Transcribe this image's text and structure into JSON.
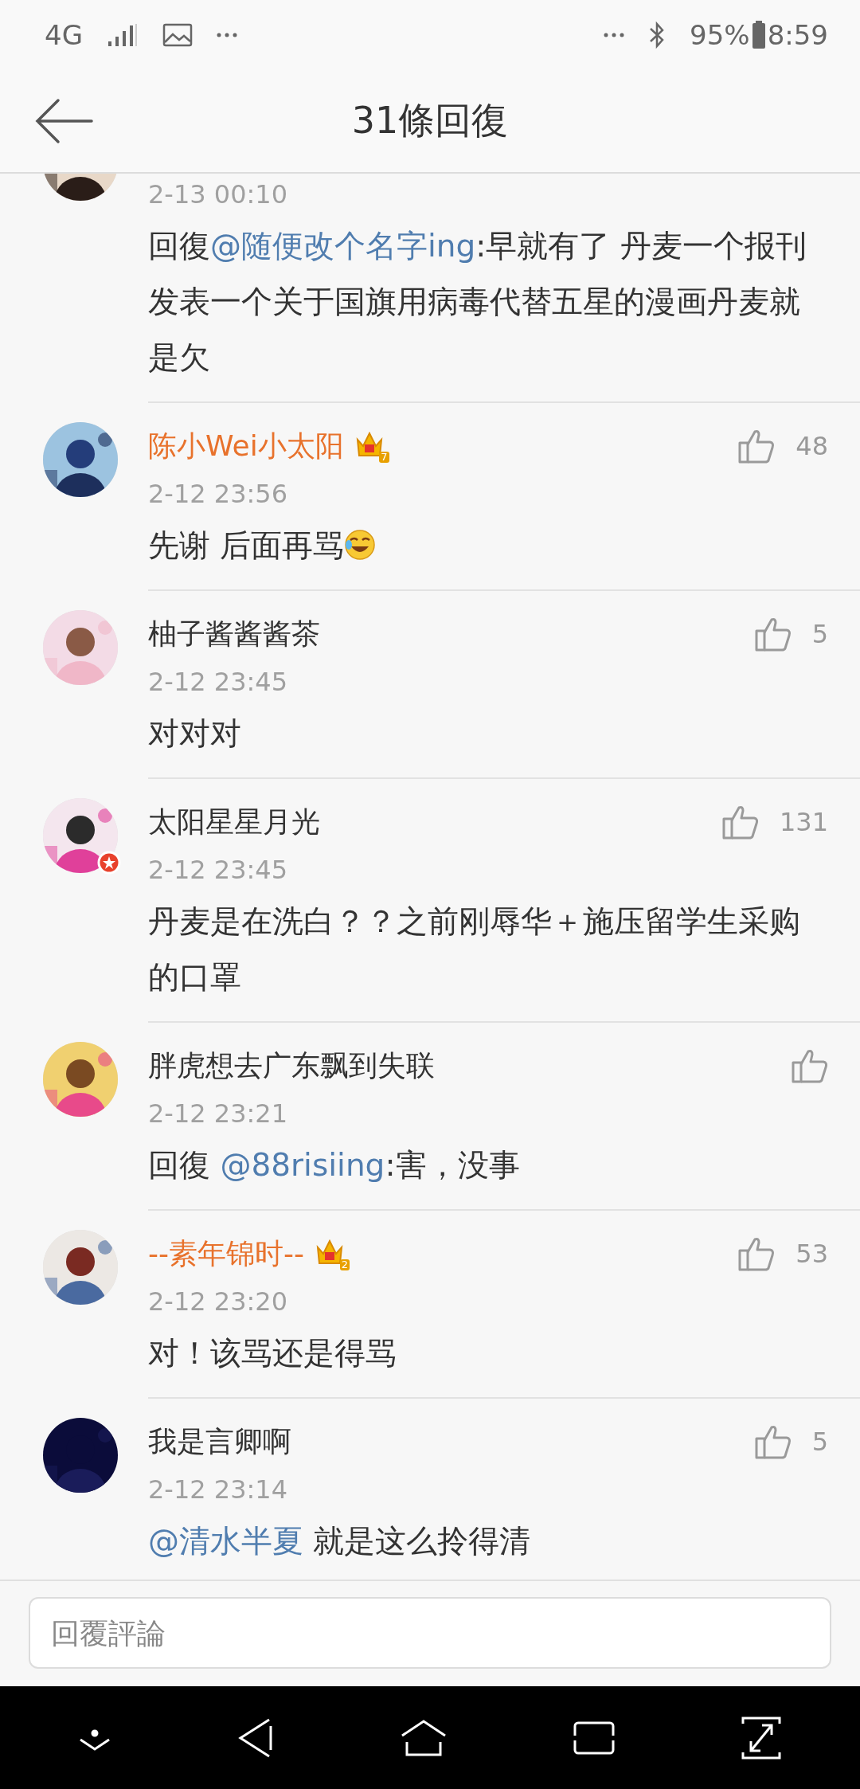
{
  "status_bar": {
    "network": "4G",
    "battery": "95%",
    "time": "8:59"
  },
  "header": {
    "title": "31條回復"
  },
  "comments": [
    {
      "kind": "cut",
      "time": "2-13 00:10",
      "avatar": {
        "kind": "picture"
      },
      "body": [
        {
          "kind": "plain",
          "text": "回復"
        },
        {
          "kind": "mention",
          "text": "@随便改个名字ing"
        },
        {
          "kind": "plain",
          "text": ":早就有了  丹麦一个报刊发表一个关于国旗用病毒代替五星的漫画丹麦就是欠"
        }
      ]
    },
    {
      "kind": "full",
      "name": "陈小Wei小太阳",
      "vip": true,
      "crown": "7",
      "verified": false,
      "likes": "48",
      "time": "2-12 23:56",
      "avatar": {
        "kind": "picture"
      },
      "body": [
        {
          "kind": "plain",
          "text": "先谢 后面再骂"
        },
        {
          "kind": "emoji"
        }
      ]
    },
    {
      "kind": "full",
      "name": "柚子酱酱酱茶",
      "vip": false,
      "verified": false,
      "likes": "5",
      "time": "2-12 23:45",
      "avatar": {
        "kind": "picture"
      },
      "body": [
        {
          "kind": "plain",
          "text": "对对对"
        }
      ]
    },
    {
      "kind": "full",
      "name": "太阳星星月光",
      "vip": false,
      "verified": true,
      "likes": "131",
      "time": "2-12 23:45",
      "avatar": {
        "kind": "picture"
      },
      "body": [
        {
          "kind": "plain",
          "text": "丹麦是在洗白？？之前刚辱华＋施压留学生采购的口罩"
        }
      ]
    },
    {
      "kind": "full",
      "name": "胖虎想去广东飘到失联",
      "vip": false,
      "verified": false,
      "time": "2-12 23:21",
      "avatar": {
        "kind": "picture"
      },
      "body": [
        {
          "kind": "plain",
          "text": "回復 "
        },
        {
          "kind": "mention",
          "text": "@88risiing"
        },
        {
          "kind": "plain",
          "text": ":害，没事"
        }
      ]
    },
    {
      "kind": "full",
      "name": "--素年锦时--",
      "vip": true,
      "crown": "2",
      "verified": false,
      "likes": "53",
      "time": "2-12 23:20",
      "avatar": {
        "kind": "picture"
      },
      "body": [
        {
          "kind": "plain",
          "text": "对！该骂还是得骂"
        }
      ]
    },
    {
      "kind": "full",
      "name": "我是言卿啊",
      "vip": false,
      "verified": false,
      "likes": "5",
      "time": "2-12 23:14",
      "avatar": {
        "kind": "picture"
      },
      "body": [
        {
          "kind": "mention",
          "text": "@清水半夏"
        },
        {
          "kind": "plain",
          "text": " 就是这么拎得清"
        }
      ]
    }
  ],
  "composer": {
    "placeholder": "回覆評論"
  }
}
